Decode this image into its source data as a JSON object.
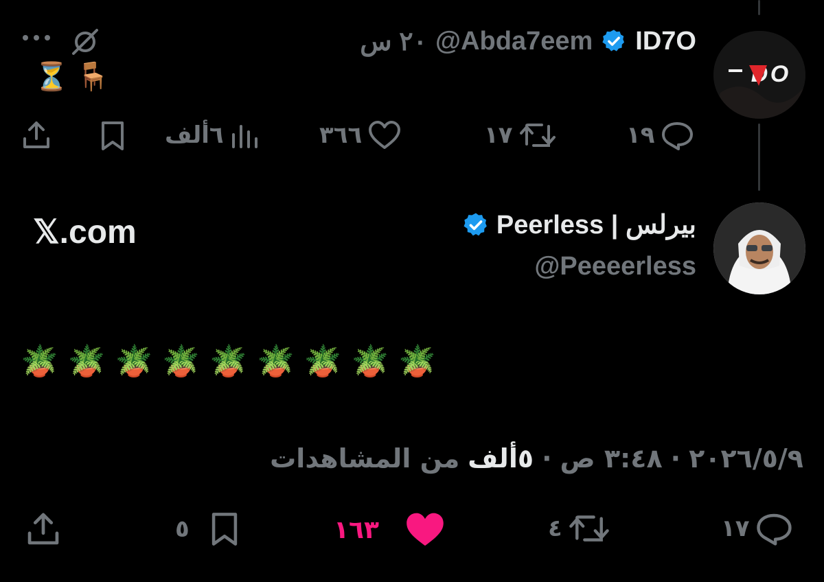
{
  "tweet1": {
    "display_name": "ID7O",
    "handle": "@Abda7eem",
    "time": "٢٠ س",
    "text_emojis": [
      "⏳",
      "🪑"
    ],
    "replies": "١٩",
    "retweets": "١٧",
    "likes": "٣٦٦",
    "views": "٦ألف"
  },
  "tweet2": {
    "display_name": "بيرلس | Peerless",
    "handle": "@Peeeerless",
    "watermark": "𝕏.com",
    "text_emojis": [
      "🪴",
      "🪴",
      "🪴",
      "🪴",
      "🪴",
      "🪴",
      "🪴",
      "🪴",
      "🪴"
    ],
    "date": "٢٠٢٦/٥/٩",
    "time": "٣:٤٨ ص",
    "views_count": "٥ألف",
    "views_label": "من المشاهدات",
    "replies": "١٧",
    "retweets": "٤",
    "likes": "١٦٣",
    "bookmarks": "٥"
  },
  "icons": {
    "verified": "verified-badge-icon",
    "more": "more-icon",
    "grok": "grok-icon",
    "reply": "reply-icon",
    "retweet": "retweet-icon",
    "like": "like-icon",
    "views": "views-icon",
    "bookmark": "bookmark-icon",
    "share": "share-icon"
  },
  "colors": {
    "background": "#000000",
    "text": "#e7e9ea",
    "muted": "#71767b",
    "verified": "#1d9bf0",
    "like_active": "#f91880"
  }
}
